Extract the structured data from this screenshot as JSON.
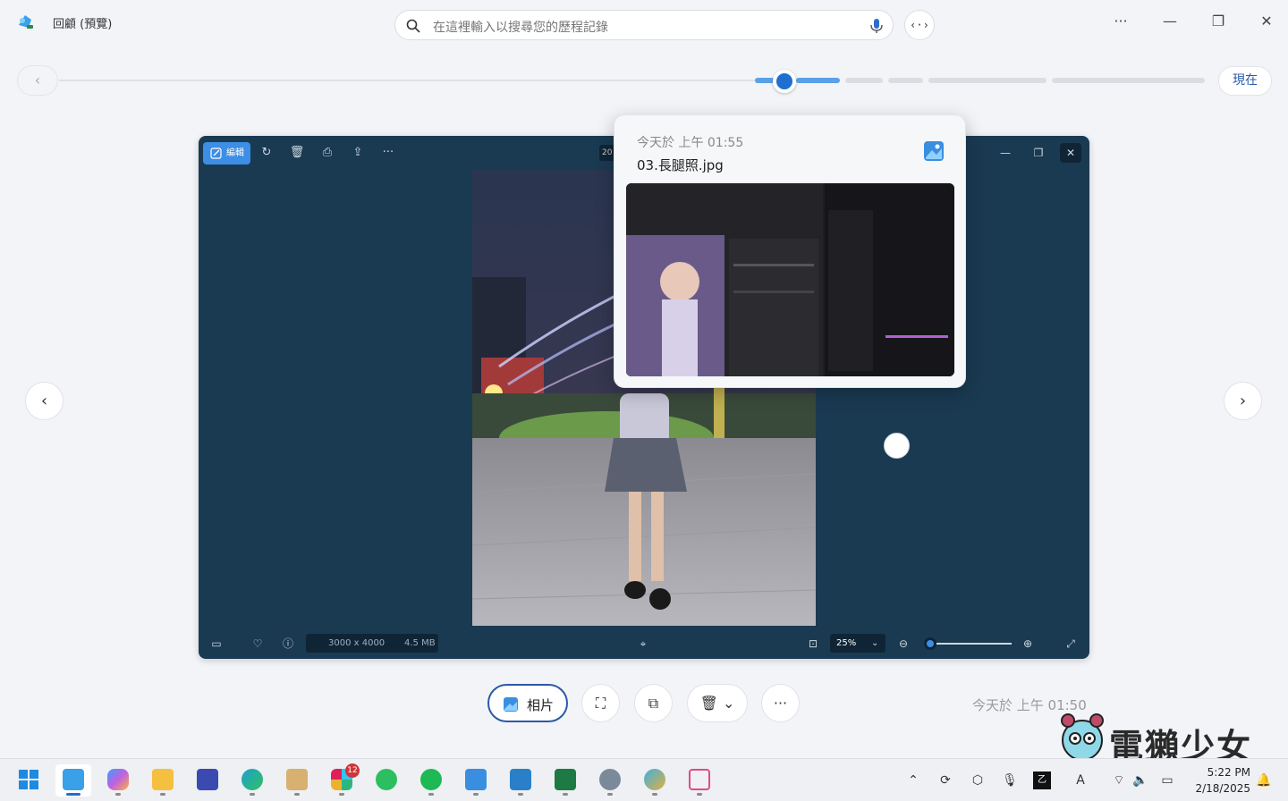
{
  "app": {
    "title": "回顧 (預覽)"
  },
  "search": {
    "placeholder": "在這裡輸入以搜尋您的歷程記錄"
  },
  "timeline": {
    "now_label": "現在",
    "position_fraction": 0.78
  },
  "snapshot": {
    "year_tag": "20",
    "edit_label": "編輯",
    "image_size": "3000 x 4000",
    "file_size": "4.5 MB",
    "zoom": "25%"
  },
  "hover_card": {
    "time": "今天於 上午 01:55",
    "file_name": "03.長腿照.jpg"
  },
  "actions": {
    "photos_label": "相片",
    "time": "今天於 上午 01:50"
  },
  "watermark": {
    "text": "電獺少女"
  },
  "taskbar": {
    "slack_badge": "12",
    "clock_time": "5:22 PM",
    "clock_date": "2/18/2025"
  },
  "colors": {
    "accent": "#1e6fd0",
    "snapshot_bg": "#1a3a52",
    "page_bg": "#f3f4f8"
  }
}
